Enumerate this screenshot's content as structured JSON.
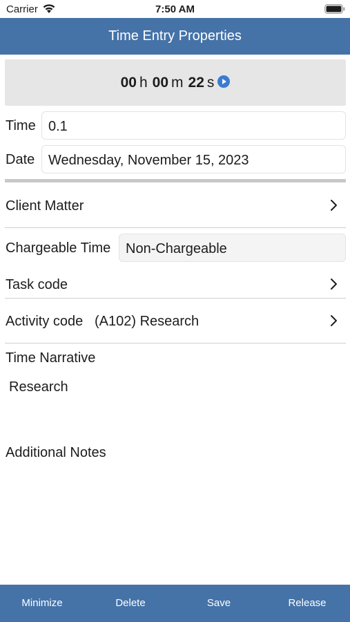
{
  "status_bar": {
    "carrier": "Carrier",
    "time": "7:50 AM"
  },
  "nav": {
    "title": "Time Entry Properties"
  },
  "timer": {
    "hours": "00",
    "hours_unit": "h",
    "minutes": "00",
    "minutes_unit": "m",
    "seconds": "22",
    "seconds_unit": "s"
  },
  "form": {
    "time_label": "Time",
    "time_value": "0.1",
    "date_label": "Date",
    "date_value": "Wednesday, November 15, 2023",
    "client_matter_label": "Client Matter",
    "chargeable_label": "Chargeable Time",
    "chargeable_value": "Non-Chargeable",
    "task_code_label": "Task code",
    "activity_code_label": "Activity code",
    "activity_code_value": "(A102) Research",
    "narrative_label": "Time Narrative",
    "narrative_value": "Research",
    "notes_label": "Additional Notes"
  },
  "toolbar": {
    "minimize": "Minimize",
    "delete": "Delete",
    "save": "Save",
    "release": "Release"
  },
  "colors": {
    "accent": "#4573a8",
    "panel": "#e6e6e6"
  }
}
